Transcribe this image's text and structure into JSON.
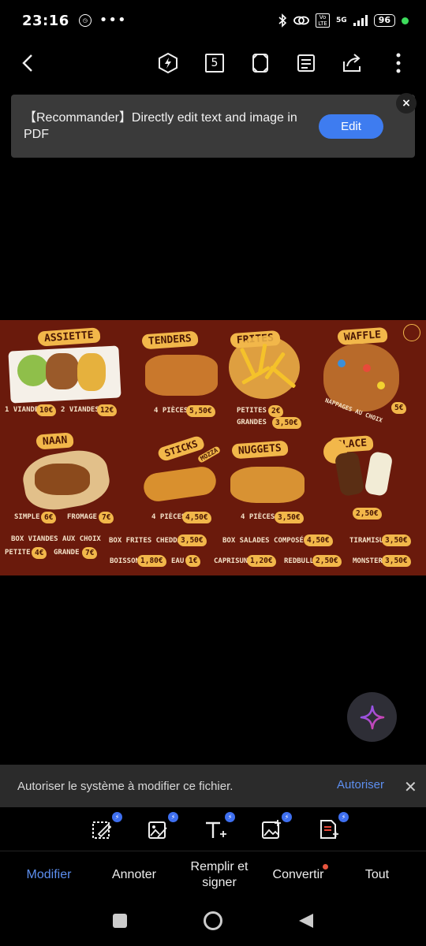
{
  "status_bar": {
    "time": "23:16",
    "icons": [
      "data-saver-icon",
      "more-dots-icon",
      "bluetooth-icon",
      "link-icon",
      "volte-icon",
      "signal-5g-icon",
      "battery-icon"
    ],
    "volte": "Vo LTE",
    "network": "5G",
    "battery": "96"
  },
  "toolbar": {
    "page_count": "5",
    "icons": [
      "back-icon",
      "ai-bolt-icon",
      "page-count-icon",
      "fullscreen-icon",
      "reading-mode-icon",
      "share-icon",
      "more-vertical-icon"
    ]
  },
  "banner": {
    "text": "【Recommander】Directly edit text and image in PDF",
    "edit_label": "Edit",
    "close_glyph": "×"
  },
  "menu": {
    "items": [
      {
        "title": "ASSIETTE",
        "lines": [
          [
            "1 VIANDE",
            "10€"
          ],
          [
            "2 VIANDES",
            "12€"
          ]
        ]
      },
      {
        "title": "TENDERS",
        "lines": [
          [
            "4 PIÈCES",
            "5,50€"
          ]
        ]
      },
      {
        "title": "FRITES",
        "lines": [
          [
            "PETITES",
            "2€"
          ],
          [
            "GRANDES",
            "3,50€"
          ]
        ]
      },
      {
        "title": "WAFFLE",
        "lines": [
          [
            "NAPPAGES AU CHOIX",
            "5€"
          ]
        ]
      },
      {
        "title": "NAAN",
        "lines": [
          [
            "SIMPLE",
            "6€"
          ],
          [
            "FROMAGE",
            "7€"
          ]
        ]
      },
      {
        "title": "STICKS",
        "subtitle": "MOZZA",
        "lines": [
          [
            "4 PIÈCES",
            "4,50€"
          ]
        ]
      },
      {
        "title": "NUGGETS",
        "lines": [
          [
            "4 PIÈCES",
            "3,50€"
          ]
        ]
      },
      {
        "title": "GLACE",
        "lines": [
          [
            "",
            "2,50€"
          ]
        ]
      }
    ],
    "extras": {
      "box_viandes": "BOX VIANDES AUX CHOIX",
      "petite": "PETITE",
      "petite_price": "4€",
      "grande": "GRANDE",
      "grande_price": "7€",
      "box_frites": "BOX FRITES CHEDDAR",
      "box_frites_price": "3,50€",
      "box_salades": "BOX SALADES COMPOSÉES",
      "box_salades_price": "4,50€",
      "tiramisu": "TIRAMISU",
      "tiramisu_price": "3,50€",
      "boisson": "BOISSON",
      "boisson_price": "1,80€",
      "eau": "EAU",
      "eau_price": "1€",
      "caprisun": "CAPRISUN",
      "caprisun_price": "1,20€",
      "redbull": "REDBULL",
      "redbull_price": "2,50€",
      "monster": "MONSTER",
      "monster_price": "3,50€"
    },
    "colors": {
      "background": "#6a1a0c",
      "label": "#f2b74a",
      "text": "#f4e2c8"
    }
  },
  "permission": {
    "text": "Autoriser le système à modifier ce fichier.",
    "button": "Autoriser",
    "close_glyph": "✕"
  },
  "edit_tools": [
    "edit-text-box-icon",
    "edit-image-icon",
    "add-text-icon",
    "add-image-icon",
    "pdf-convert-icon"
  ],
  "tabs": [
    {
      "label": "Modifier",
      "active": true
    },
    {
      "label": "Annoter"
    },
    {
      "label": "Remplir et signer"
    },
    {
      "label": "Convertir",
      "badge": true
    },
    {
      "label": "Tout"
    }
  ],
  "nav": [
    "recents-square-icon",
    "home-circle-icon",
    "back-triangle-icon"
  ]
}
